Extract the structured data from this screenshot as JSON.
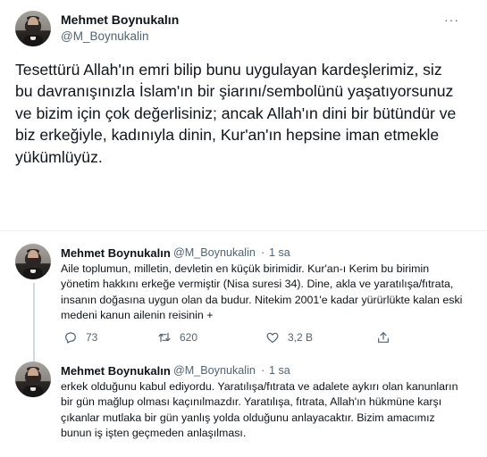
{
  "main_tweet": {
    "author_name": "Mehmet Boynukalın",
    "author_handle": "@M_Boynukalin",
    "more_label": "···",
    "text": "Tesettürü Allah'ın emri bilip bunu uygulayan kardeşlerimiz, siz bu davranışınızla İslam'ın bir şiarını/sembolünü yaşatıyorsunuz ve bizim için çok değerlisiniz; ancak Allah'ın dini bir bütündür ve biz erkeğiyle,  kadınıyla dinin, Kur'an'ın hepsine iman etmekle yükümlüyüz."
  },
  "replies": [
    {
      "author_name": "Mehmet Boynukalın",
      "author_handle": "@M_Boynukalin",
      "separator": "·",
      "time": "1 sa",
      "text": "Aile toplumun, milletin, devletin en küçük birimidir. Kur'an-ı Kerim bu birimin yönetim hakkını erkeğe vermiştir (Nisa suresi 34). Dine, akla ve yaratılışa/fıtrata, insanın doğasına uygun olan da budur. Nitekim 2001'e kadar yürürlükte kalan eski medeni kanun ailenin reisinin +",
      "reply_count": "73",
      "retweet_count": "620",
      "like_count": "3,2 B",
      "icons": [
        "reply-icon",
        "retweet-icon",
        "like-icon",
        "share-icon"
      ]
    },
    {
      "author_name": "Mehmet Boynukalın",
      "author_handle": "@M_Boynukalin",
      "separator": "·",
      "time": "1 sa",
      "text": "erkek olduğunu kabul ediyordu. Yaratılışa/fıtrata ve adalete aykırı olan kanunların bir gün mağlup olması kaçınılmazdır. Yaratılışa, fıtrata, Allah'ın hükmüne karşı çıkanlar mutlaka bir gün yanlış yolda olduğunu anlayacaktır. Bizim amacımız bunun iş işten geçmeden anlaşılması."
    }
  ],
  "colors": {
    "text": "#0f1419",
    "secondary": "#536471",
    "divider": "#eff3f4",
    "thread_line": "#cfd9de"
  }
}
